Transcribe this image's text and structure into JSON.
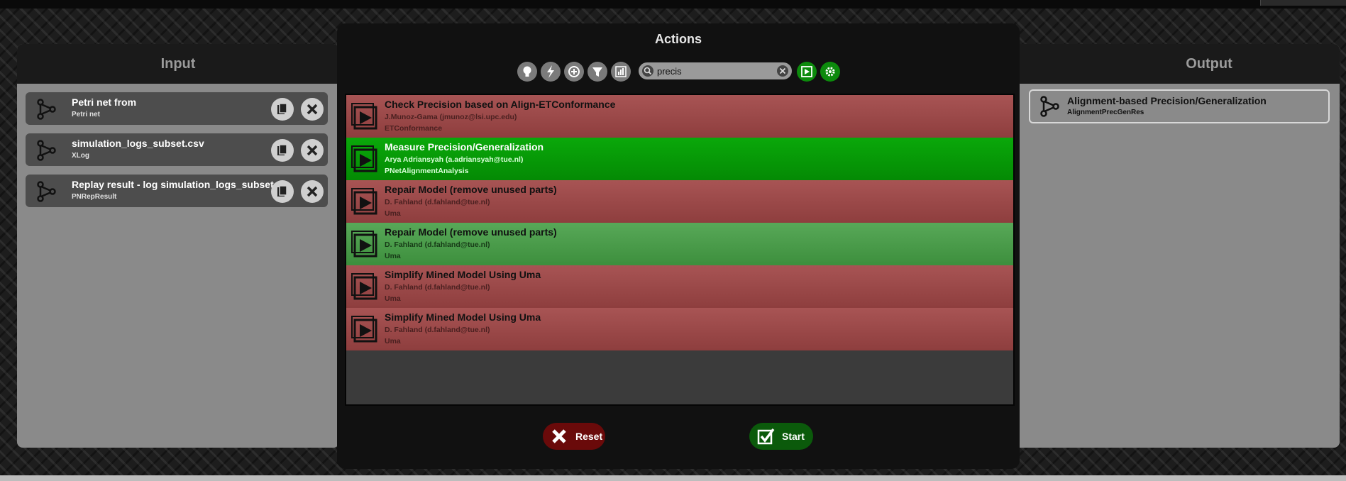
{
  "input_panel": {
    "title": "Input",
    "items": [
      {
        "name": "Petri net from",
        "type": "Petri net"
      },
      {
        "name": "simulation_logs_subset.csv",
        "type": "XLog"
      },
      {
        "name": "Replay result - log simulation_logs_subset.c...",
        "type": "PNRepResult"
      }
    ]
  },
  "output_panel": {
    "title": "Output",
    "items": [
      {
        "name": "Alignment-based Precision/Generalization",
        "type": "AlignmentPrecGenRes"
      }
    ]
  },
  "actions_dialog": {
    "title": "Actions",
    "toolbar": {
      "icons": [
        "lightbulb-icon",
        "lightning-icon",
        "plus-circle-icon",
        "filter-icon",
        "chart-icon"
      ],
      "search_value": "precis"
    },
    "actions": [
      {
        "name": "Check Precision based on Align-ETConformance",
        "author": "J.Munoz-Gama (jmunoz@lsi.upc.edu)",
        "package": "ETConformance",
        "status": "red"
      },
      {
        "name": "Measure Precision/Generalization",
        "author": "Arya Adriansyah (a.adriansyah@tue.nl)",
        "package": "PNetAlignmentAnalysis",
        "status": "selected"
      },
      {
        "name": "Repair Model (remove unused parts)",
        "author": "D. Fahland (d.fahland@tue.nl)",
        "package": "Uma",
        "status": "red"
      },
      {
        "name": "Repair Model (remove unused parts)",
        "author": "D. Fahland (d.fahland@tue.nl)",
        "package": "Uma",
        "status": "green"
      },
      {
        "name": "Simplify Mined Model Using Uma",
        "author": "D. Fahland (d.fahland@tue.nl)",
        "package": "Uma",
        "status": "red"
      },
      {
        "name": "Simplify Mined Model Using Uma",
        "author": "D. Fahland (d.fahland@tue.nl)",
        "package": "Uma",
        "status": "red"
      }
    ],
    "reset_label": "Reset",
    "start_label": "Start"
  },
  "colors": {
    "action_red": "#a85454",
    "action_selected": "#0aa80a",
    "action_green": "#58a858",
    "reset_bg": "#6a0a0a",
    "start_bg": "#0b5a0b"
  }
}
